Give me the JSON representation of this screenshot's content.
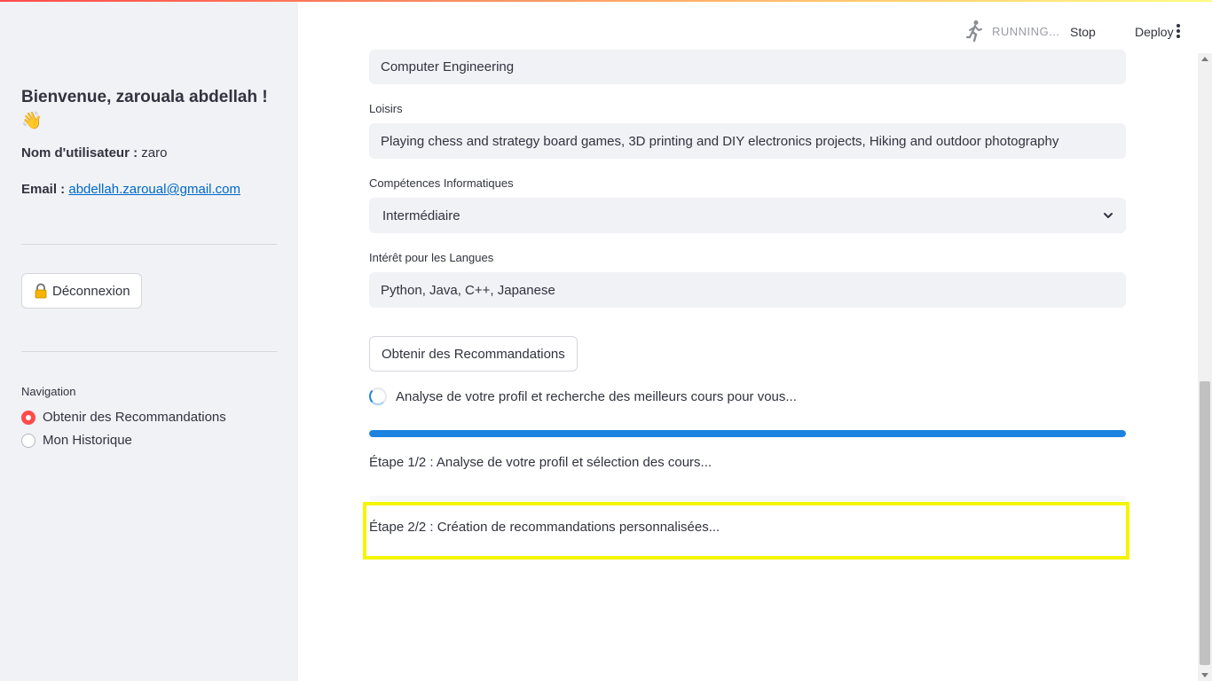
{
  "sidebar": {
    "welcome": "Bienvenue, zarouala abdellah !",
    "welcome_emoji": "👋",
    "username_label": "Nom d'utilisateur :",
    "username_value": "zaro",
    "email_label": "Email :",
    "email_value": "abdellah.zaroual@gmail.com",
    "logout_icon": "lock-icon",
    "logout_label": "Déconnexion",
    "nav_label": "Navigation",
    "nav_items": [
      {
        "label": "Obtenir des Recommandations",
        "selected": true
      },
      {
        "label": "Mon Historique",
        "selected": false
      }
    ]
  },
  "header": {
    "status": "RUNNING...",
    "status_icon": "running-man-icon",
    "stop_label": "Stop",
    "deploy_label": "Deploy",
    "menu_icon": "kebab-menu-icon"
  },
  "form": {
    "field_of_study_value": "Computer Engineering",
    "hobbies_label": "Loisirs",
    "hobbies_value": "Playing chess and strategy board games, 3D printing and DIY electronics projects, Hiking and outdoor photography",
    "it_skills_label": "Compétences Informatiques",
    "it_skills_value": "Intermédiaire",
    "languages_label": "Intérêt pour les Langues",
    "languages_value": "Python, Java, C++, Japanese",
    "submit_label": "Obtenir des Recommandations"
  },
  "status": {
    "spinner_text": "Analyse de votre profil et recherche des meilleurs cours pour vous...",
    "progress": 1.0,
    "step1": "Étape 1/2 : Analyse de votre profil et sélection des cours...",
    "step2": "Étape 2/2 : Création de recommandations personnalisées..."
  },
  "colors": {
    "accent": "#ff4b4b",
    "progress": "#1c83e1",
    "link": "#0068c9",
    "highlight": "#f5f500"
  }
}
